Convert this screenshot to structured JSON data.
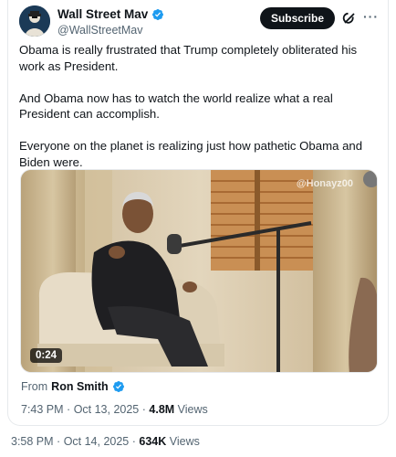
{
  "quoted_post": {
    "author": {
      "display_name": "Wall Street Mav",
      "handle": "@WallStreetMav",
      "verified": true
    },
    "subscribe_label": "Subscribe",
    "more_label": "···",
    "paragraphs": [
      "Obama is really frustrated that Trump completely obliterated his work as President.",
      "And Obama now has to watch the world realize what a real President can accomplish.",
      "Everyone on the planet is realizing just how pathetic Obama and Biden were."
    ],
    "video": {
      "duration": "0:24",
      "watermark": "@Honayz00"
    },
    "from_label": "From",
    "from_name": "Ron Smith",
    "time": "7:43 PM",
    "date": "Oct 13, 2025",
    "views_count": "4.8M",
    "views_label": "Views"
  },
  "outer_post": {
    "time": "3:58 PM",
    "date": "Oct 14, 2025",
    "views_count": "634K",
    "views_label": "Views"
  },
  "colors": {
    "verified_blue": "#1d9bf0",
    "text_primary": "#0f1419",
    "text_secondary": "#536471"
  },
  "icons": {
    "verified": "verified-badge-icon",
    "grok": "grok-icon",
    "more": "more-icon"
  }
}
